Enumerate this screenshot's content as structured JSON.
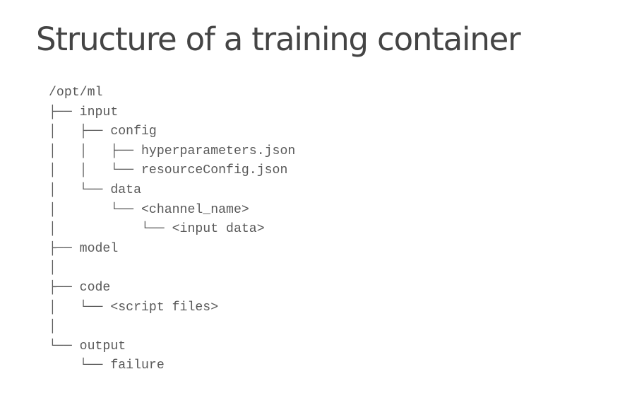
{
  "slide": {
    "title": "Structure of a training container"
  },
  "tree": {
    "lines": [
      {
        "prefix": "",
        "name": "/opt/ml"
      },
      {
        "prefix": "├── ",
        "name": "input"
      },
      {
        "prefix": "│   ├── ",
        "name": "config"
      },
      {
        "prefix": "│   │   ├── ",
        "name": "hyperparameters.json"
      },
      {
        "prefix": "│   │   └── ",
        "name": "resourceConfig.json"
      },
      {
        "prefix": "│   └── ",
        "name": "data"
      },
      {
        "prefix": "│       └── ",
        "name": "<channel_name>"
      },
      {
        "prefix": "│           └── ",
        "name": "<input data>"
      },
      {
        "prefix": "├── ",
        "name": "model"
      },
      {
        "prefix": "│",
        "name": ""
      },
      {
        "prefix": "├── ",
        "name": "code"
      },
      {
        "prefix": "│   └── ",
        "name": "<script files>"
      },
      {
        "prefix": "│",
        "name": ""
      },
      {
        "prefix": "└── ",
        "name": "output"
      },
      {
        "prefix": "    └── ",
        "name": "failure"
      }
    ]
  }
}
